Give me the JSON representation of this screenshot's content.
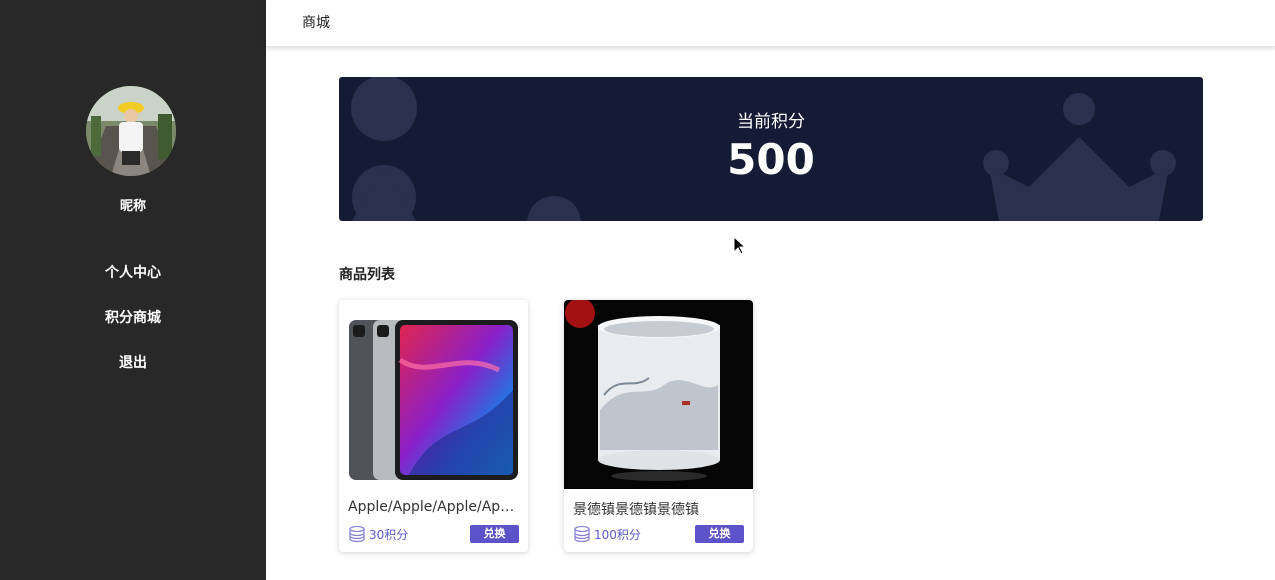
{
  "sidebar": {
    "nickname": "昵称",
    "nav": [
      {
        "label": "个人中心"
      },
      {
        "label": "积分商城"
      },
      {
        "label": "退出"
      }
    ]
  },
  "header": {
    "title": "商城"
  },
  "banner": {
    "label": "当前积分",
    "points": "500"
  },
  "products_title": "商品列表",
  "products": [
    {
      "name": "Apple/Apple/Apple/Apple/Apple",
      "price": "30积分",
      "button": "兑换",
      "icon": "coin-stack-icon"
    },
    {
      "name": "景德镇景德镇景德镇",
      "price": "100积分",
      "button": "兑换",
      "icon": "coin-stack-icon"
    }
  ],
  "colors": {
    "sidebar_bg": "#282828",
    "banner_bg": "#161b35",
    "accent": "#5b53c7"
  }
}
